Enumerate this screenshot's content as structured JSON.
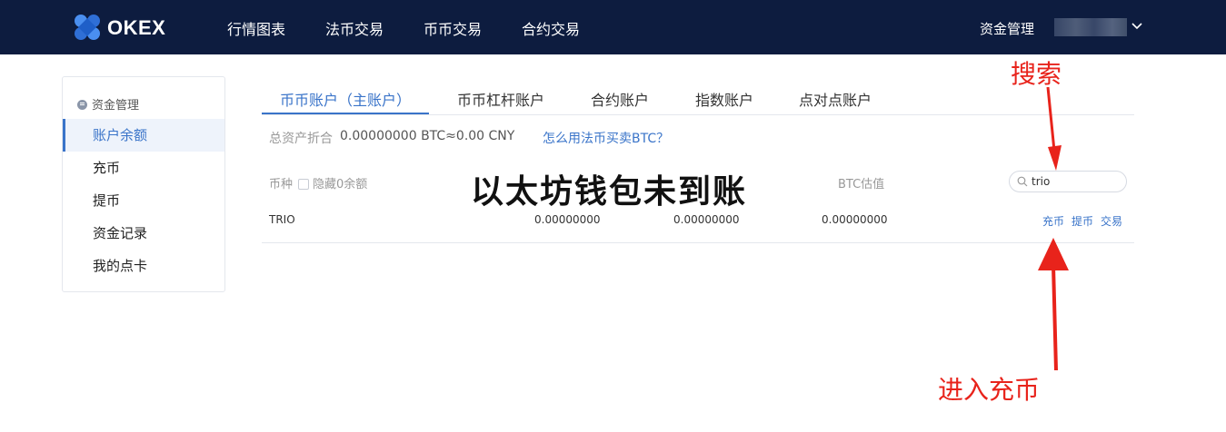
{
  "header": {
    "logo_text": "OKEX",
    "nav": [
      "行情图表",
      "法币交易",
      "币币交易",
      "合约交易"
    ],
    "funds_management": "资金管理"
  },
  "sidebar": {
    "heading": "资金管理",
    "items": [
      {
        "label": "账户余额",
        "active": true
      },
      {
        "label": "充币",
        "active": false
      },
      {
        "label": "提币",
        "active": false
      },
      {
        "label": "资金记录",
        "active": false
      },
      {
        "label": "我的点卡",
        "active": false
      }
    ]
  },
  "tabs": [
    {
      "label": "币币账户（主账户）",
      "active": true
    },
    {
      "label": "币币杠杆账户",
      "active": false
    },
    {
      "label": "合约账户",
      "active": false
    },
    {
      "label": "指数账户",
      "active": false
    },
    {
      "label": "点对点账户",
      "active": false
    }
  ],
  "summary": {
    "label": "总资产折合",
    "value": "0.00000000 BTC≈0.00 CNY",
    "help_link": "怎么用法币买卖BTC？"
  },
  "table": {
    "header": {
      "currency": "币种",
      "hide_zero": "隐藏0余额",
      "btc_value": "BTC估值"
    },
    "search": {
      "value": "trio"
    },
    "rows": [
      {
        "currency": "TRIO",
        "col2": "0.00000000",
        "col3": "0.00000000",
        "btc_value": "0.00000000",
        "actions": [
          "充币",
          "提币",
          "交易"
        ]
      }
    ]
  },
  "overlay": {
    "watermark": "以太坊钱包未到账",
    "annotation_search": "搜索",
    "annotation_deposit": "进入充币"
  },
  "colors": {
    "nav_bg": "#0d1c3f",
    "accent": "#3a74c9",
    "annotation": "#e8231b"
  }
}
